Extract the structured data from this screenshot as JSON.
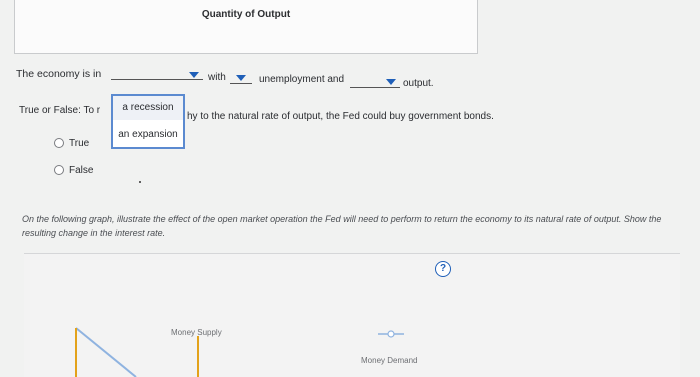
{
  "graph_top": {
    "axis_label": "Quantity of Output"
  },
  "question1": {
    "prefix": "The economy is in",
    "with_text": "with",
    "unemployment_text": "unemployment and",
    "output_text": "output."
  },
  "dropdown_menu": {
    "options": [
      "a recession",
      "an expansion"
    ]
  },
  "question2": {
    "prefix": "True or False: To r",
    "suffix": "hy to the natural rate of output, the Fed could buy government bonds.",
    "options": [
      "True",
      "False"
    ]
  },
  "instruction": {
    "text": "On the following graph, illustrate the effect of the open market operation the Fed will need to perform to return the economy to its natural rate of output. Show the resulting change in the interest rate."
  },
  "graph": {
    "help_symbol": "?",
    "money_supply_label": "Money Supply",
    "money_demand_label": "Money Demand",
    "money_supply_color": "#e3a21a",
    "money_demand_color": "#1f5fb8"
  }
}
